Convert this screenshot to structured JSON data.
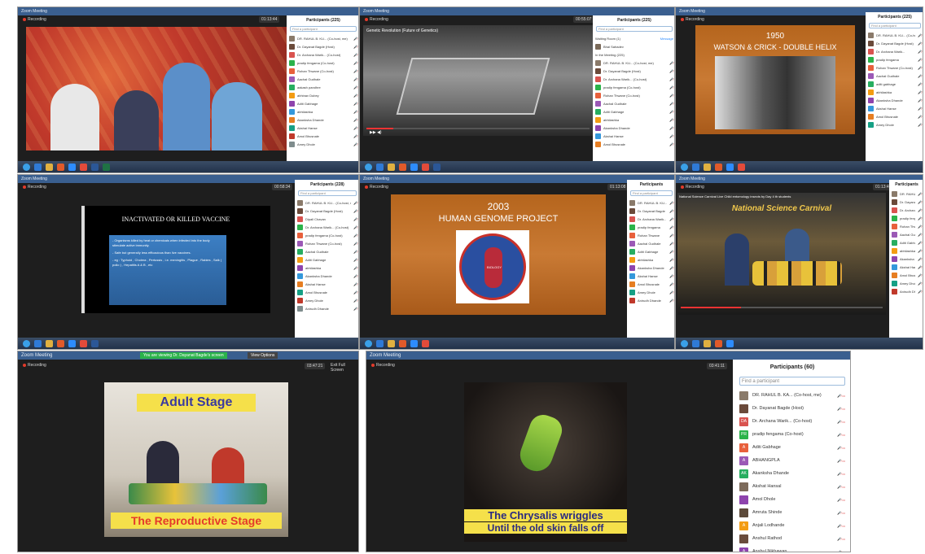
{
  "app": {
    "window_title": "Zoom Meeting",
    "recording_label": "Recording"
  },
  "frames": {
    "f1": {
      "timer": "01:13:44",
      "participants_title": "Participants (225)",
      "search_placeholder": "Find a participant",
      "participants": [
        "DR. RAHUL B. KU... (Co-host, me)",
        "Dr. Dayanat Bagde (Host)",
        "Dr. Archana Warik... (Co-host)",
        "pradip fengama (Co-host)",
        "Rohan Thwane (Co-host)",
        "Aachal Gudhale",
        "aakash pandhre",
        "abhinav Dubey",
        "Aditi Gabhage",
        "abhilashka",
        "Akanksha Dhande",
        "Akshai Hanse",
        "Amol Bhusnale",
        "Amey Dhole"
      ]
    },
    "f2": {
      "timer": "00:55:07",
      "participants_title": "Participants (225)",
      "video_title": "Genetic Revolution (Future of Genetics)",
      "waiting_label": "Waiting Room (1)",
      "waiting_person": "Bhai Sahadev",
      "in_meeting_label": "In the Meeting (225)",
      "message_label": "Message",
      "participants": [
        "DR. RAHUL B. KU... (Co-host, me)",
        "Dr. Dayanat Bagde (Host)",
        "Dr. Archana Warik... (Co-host)",
        "pradip fengama (Co-host)",
        "Rohan Thwane (Co-host)",
        "Aachal Gudhale",
        "Aditi Gabhage",
        "abhilashka",
        "Akanksha Dhande",
        "Akshai Hanse",
        "Amol Bhusnale"
      ]
    },
    "f3": {
      "slide_year": "1950",
      "slide_title": "WATSON & CRICK - DOUBLE HELIX",
      "participants_title": "Participants (225)",
      "participants": [
        "DR. RAHUL B. KU... (Co-host, me)",
        "Dr. Dayanat Bagde (Host)",
        "Dr. Archana Warik...",
        "pradip fengama",
        "Rohan Thwane (Co-host)",
        "Aachal Gudhale",
        "aditi gabhage",
        "abhilashka",
        "Akanksha Dhande",
        "Akshai Hanse",
        "Amol Bhusnale",
        "Amey Dhole"
      ]
    },
    "f4": {
      "timer": "00:58:34",
      "slide_title": "INACTIVATED OR KILLED VACCINE",
      "participants_title": "Participants (228)",
      "slide_text": [
        "- Organisms killed by heat or chemicals when infected into the body stimulate active immunity.",
        "- Safe but generally less efficacious than live vaccines.",
        "- eg : Typhoid , Cholera , Pertussis , i.e. meningitis , Plague , Rabies , Salk ( polio ) , Hepatitis A & B , etc"
      ],
      "participants": [
        "DR. RAHUL B. KU... (Co-host, me)",
        "Dr. Dayanat Bagde (Host)",
        "Dipali Chavan",
        "Dr. Archana Warik... (Co-host)",
        "pradip fengama (Co-host)",
        "Rohan Thwane (Co-host)",
        "Aachal Gudhale",
        "Aditi Gabhage",
        "abhilashka",
        "Akanksha Dhande",
        "Akshai Hanse",
        "Amol Bhusnale",
        "Amey Dhole",
        "Anirudh Dhande"
      ]
    },
    "f5": {
      "timer": "01:13:08",
      "slide_year": "2003",
      "slide_title": "HUMAN GENOME PROJECT",
      "participants_title": "Participants",
      "logo_words": [
        "CHEMISTRY",
        "BIOLOGY",
        "PHYSICS",
        "ETHICS",
        "INFORMATICS",
        "ENGINEERING"
      ],
      "participants": [
        "DR. RAHUL B. KU...",
        "Dr. Dayanat Bagde",
        "Dr. Archana Warik...",
        "pradip fengama",
        "Rohan Thwane",
        "Aachal Gudhale",
        "Aditi Gabhage",
        "abhilashka",
        "Akanksha Dhande",
        "Akshai Hanse",
        "Amol Bhusnale",
        "Amey Dhole",
        "Anirudh Dhande"
      ]
    },
    "f6": {
      "timer": "01:13:46",
      "video_title": "National Science Carnival Live Child entomology insects by Day 4 th students",
      "banner_text": "National Science Carnival",
      "participants_title": "Participants",
      "participants": [
        "DR. RAHUL B. KU...",
        "Dr. Dayanat Bagde",
        "Dr. Archana Warik...",
        "pradip fengama",
        "Rohan Thwane",
        "Aachal Gudhale",
        "Aditi Gabhage",
        "abhilashka",
        "Akanksha Dhande",
        "Akshai Hanse",
        "Amol Bhusnale",
        "Amey Dhole",
        "Anirudh Dhande"
      ]
    },
    "f7": {
      "timer": "03:47:21",
      "sharing_banner": "You are viewing Dr. Dayanat Bagde's screen",
      "view_options": "View Options",
      "exit_fullscreen": "Exit Full Screen",
      "caption_top": "Adult Stage",
      "caption_bottom": "The Reproductive Stage"
    },
    "f8": {
      "timer": "03:41:11",
      "participants_title": "Participants (60)",
      "search_placeholder": "Find a participant",
      "caption_line1": "The Chrysalis wriggles",
      "caption_line2": "Until the old skin falls off",
      "participants": [
        {
          "initials": "",
          "name": "DR. RAHUL B. KA... (Co-host, me)",
          "color": "#8a7a6a"
        },
        {
          "initials": "",
          "name": "Dr. Dayanat Bagde (Host)",
          "color": "#6b4a3a"
        },
        {
          "initials": "DA",
          "name": "Dr. Archana Warik... (Co-host)",
          "color": "#d9534f"
        },
        {
          "initials": "PR",
          "name": "pradip fengama (Co-host)",
          "color": "#2bb34a"
        },
        {
          "initials": "A",
          "name": "Aditi Gabhage",
          "color": "#e8603c"
        },
        {
          "initials": "A",
          "name": "ABHANGPLA",
          "color": "#9b59b6"
        },
        {
          "initials": "AK",
          "name": "Akanksha Dhande",
          "color": "#27ae60"
        },
        {
          "initials": "",
          "name": "Akshat Hansal",
          "color": "#7d6b5b"
        },
        {
          "initials": "",
          "name": "Amol Dhole",
          "color": "#8e44ad"
        },
        {
          "initials": "",
          "name": "Amruta Shinde",
          "color": "#5d4a3a"
        },
        {
          "initials": "A",
          "name": "Anjali Lodhande",
          "color": "#f39c12"
        },
        {
          "initials": "",
          "name": "Anshul Rathod",
          "color": "#6a4c3c"
        },
        {
          "initials": "A",
          "name": "Anshul Nikhawan",
          "color": "#8e44ad"
        }
      ]
    }
  },
  "colors": {
    "accent": "#2d8cff",
    "title_bar": "#3a5f8f",
    "mic_muted": "#dd3333"
  }
}
